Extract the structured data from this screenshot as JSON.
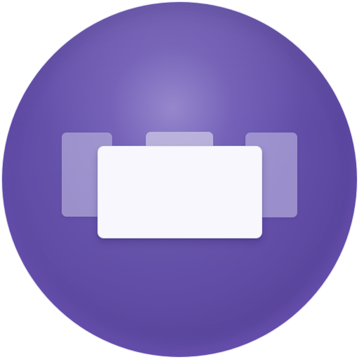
{
  "icon": {
    "semantic": "stacked-windows-icon",
    "colors": {
      "background": "#ffffff",
      "disc": "#624ea8",
      "disc_highlight": "#8b7bd0",
      "front_card": "#f7f7fd",
      "back_card": "#b2aad8"
    }
  }
}
